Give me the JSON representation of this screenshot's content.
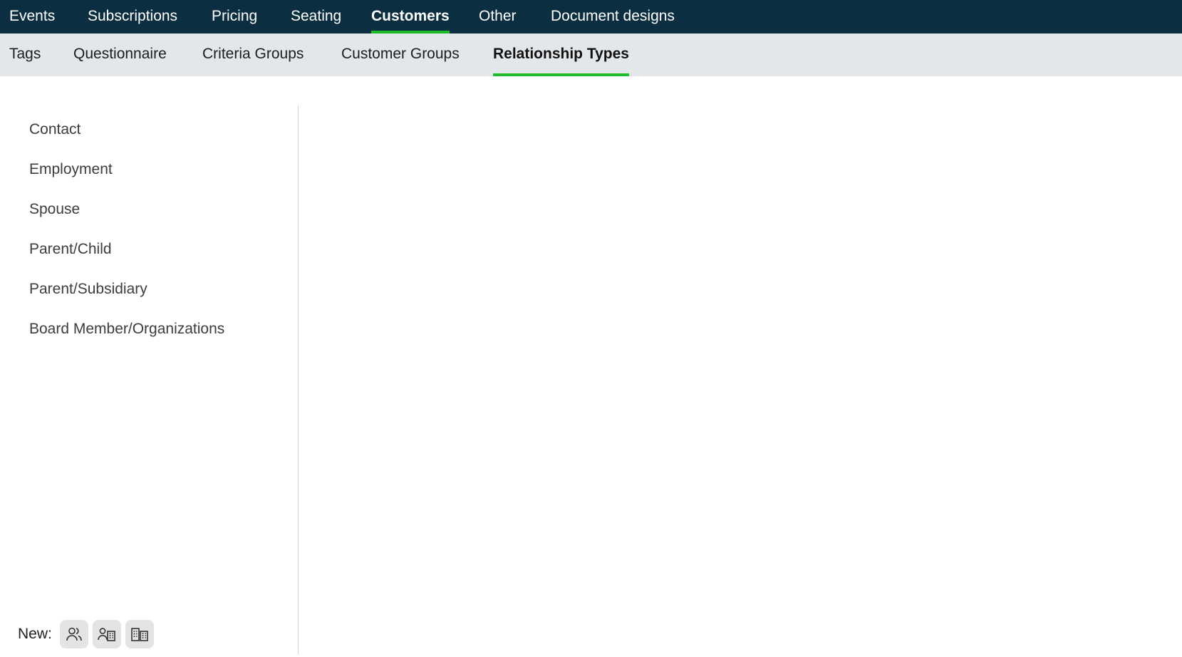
{
  "top_nav": {
    "items": [
      {
        "label": "Events"
      },
      {
        "label": "Subscriptions"
      },
      {
        "label": "Pricing"
      },
      {
        "label": "Seating"
      },
      {
        "label": "Customers",
        "active": true
      },
      {
        "label": "Other"
      },
      {
        "label": "Document designs"
      }
    ]
  },
  "sub_nav": {
    "items": [
      {
        "label": "Tags"
      },
      {
        "label": "Questionnaire"
      },
      {
        "label": "Criteria Groups"
      },
      {
        "label": "Customer Groups"
      },
      {
        "label": "Relationship Types",
        "active": true
      }
    ]
  },
  "relationship_types": [
    {
      "label": "Contact"
    },
    {
      "label": "Employment"
    },
    {
      "label": "Spouse"
    },
    {
      "label": "Parent/Child"
    },
    {
      "label": "Parent/Subsidiary"
    },
    {
      "label": "Board Member/Organizations"
    }
  ],
  "new_bar": {
    "label": "New:",
    "buttons": [
      {
        "icon": "person-person-icon"
      },
      {
        "icon": "person-organization-icon"
      },
      {
        "icon": "organization-organization-icon"
      }
    ]
  },
  "colors": {
    "top_nav_bg": "#0c2e41",
    "sub_nav_bg": "#e4e7ea",
    "accent": "#1fbb2a"
  }
}
